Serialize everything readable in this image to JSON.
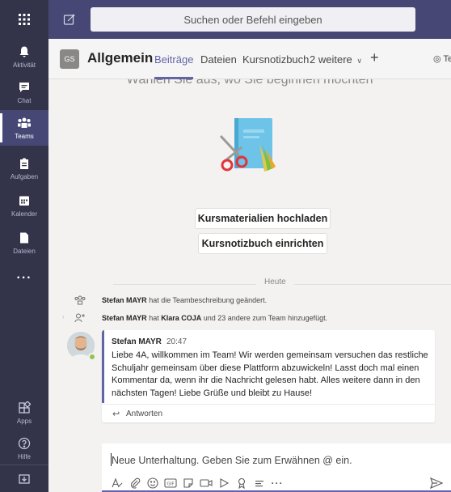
{
  "colors": {
    "rail_bg": "#33344a",
    "topbar_bg": "#464775",
    "accent": "#6264a7",
    "presence": "#92c353"
  },
  "topbar": {
    "search_placeholder": "Suchen oder Befehl eingeben",
    "grid_icon": "app-launcher-icon",
    "compose_icon": "new-chat-icon"
  },
  "rail": {
    "items": [
      {
        "label": "Aktivität",
        "icon": "bell-icon"
      },
      {
        "label": "Chat",
        "icon": "chat-icon"
      },
      {
        "label": "Teams",
        "icon": "teams-icon"
      },
      {
        "label": "Aufgaben",
        "icon": "assignments-icon"
      },
      {
        "label": "Kalender",
        "icon": "calendar-icon"
      },
      {
        "label": "Dateien",
        "icon": "files-icon"
      },
      {
        "label": "···",
        "icon": "more-apps-icon"
      }
    ],
    "bottom": [
      {
        "label": "Apps",
        "icon": "apps-icon"
      },
      {
        "label": "Hilfe",
        "icon": "help-icon"
      }
    ]
  },
  "channel": {
    "avatar": "GS",
    "name": "Allgemein",
    "tabs": [
      {
        "label": "Beiträge",
        "active": true
      },
      {
        "label": "Dateien",
        "active": false
      },
      {
        "label": "Kursnotizbuch",
        "active": false
      },
      {
        "label": "2 weitere",
        "active": false
      }
    ],
    "team_button": "Te"
  },
  "welcome": {
    "cut_text": "Wählen Sie aus, wo Sie beginnen möchten",
    "button_upload": "Kursmaterialien hochladen",
    "button_notebook": "Kursnotizbuch einrichten"
  },
  "feed": {
    "date_label": "Heute",
    "events": [
      {
        "actor": "Stefan MAYR",
        "text": " hat die Teambeschreibung geändert."
      },
      {
        "actor": "Stefan MAYR",
        "mid": " hat ",
        "target": "Klara COJA",
        "text": " und 23 andere zum Team hinzugefügt."
      }
    ],
    "message": {
      "author": "Stefan MAYR",
      "time": "20:47",
      "body": "Liebe 4A, willkommen im Team! Wir werden gemeinsam versuchen das restliche Schuljahr gemeinsam über diese Plattform abzuwickeln! Lasst doch mal einen Kommentar da, wenn ihr die Nachricht gelesen habt. Alles weitere dann in den nächsten Tagen! Liebe Grüße und bleibt zu Hause!",
      "reply_label": "Antworten"
    }
  },
  "compose": {
    "placeholder": "Neue Unterhaltung. Geben Sie zum Erwähnen @ ein.",
    "tools": [
      "format-icon",
      "attach-icon",
      "emoji-icon",
      "gif-icon",
      "sticker-icon",
      "meet-now-icon",
      "stream-icon",
      "praise-icon",
      "apps-extension-icon",
      "more-options-icon"
    ]
  }
}
